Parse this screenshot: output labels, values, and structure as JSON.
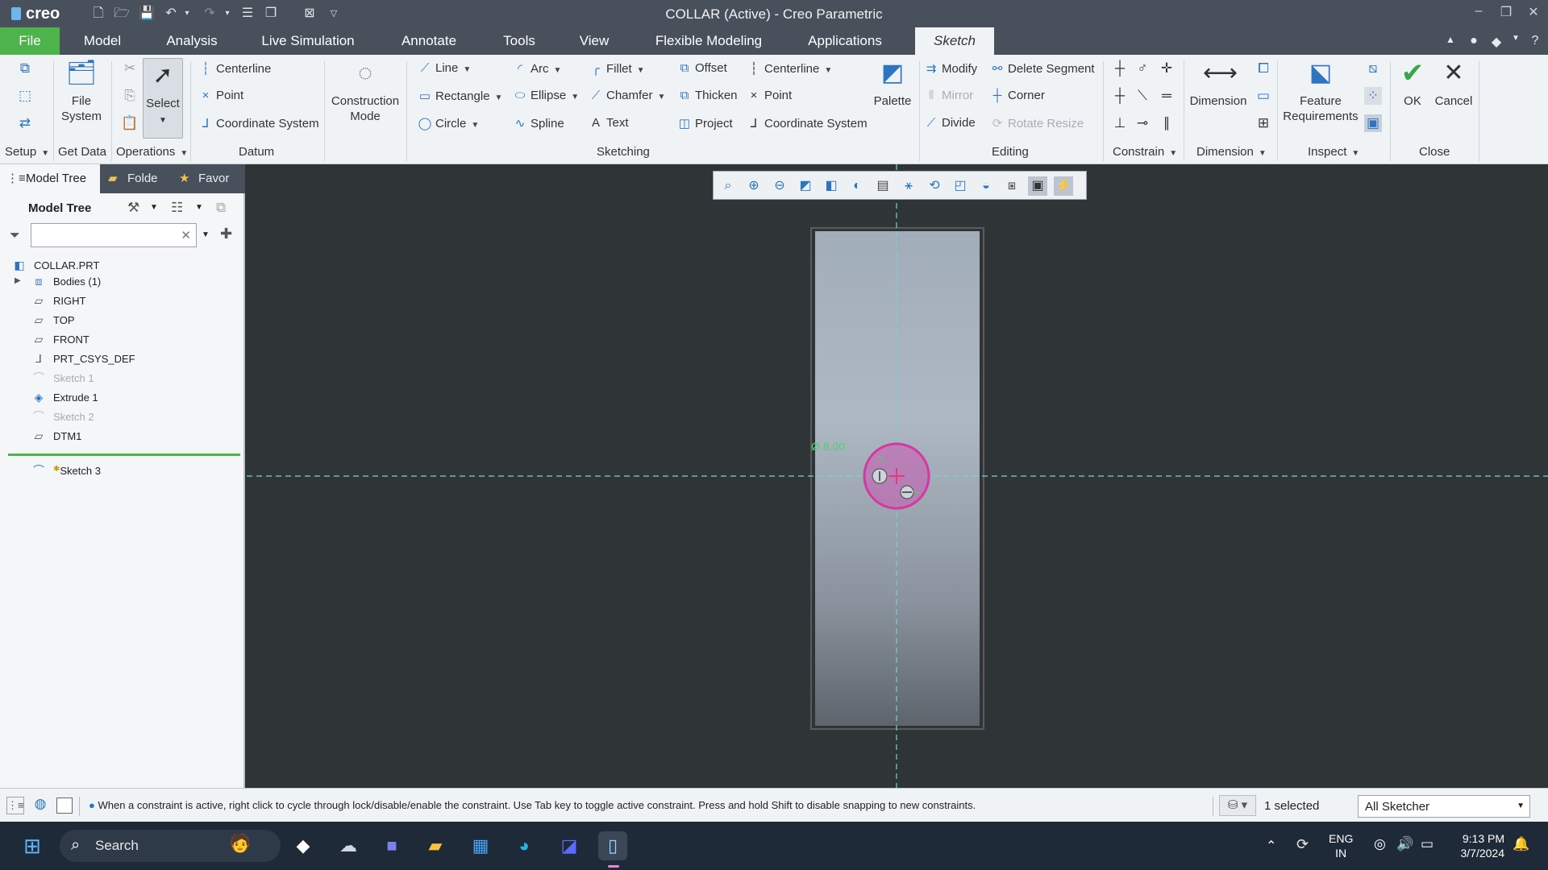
{
  "app": {
    "logo": "creo",
    "window_title": "COLLAR (Active) - Creo Parametric"
  },
  "menu_tabs": {
    "file": "File",
    "model": "Model",
    "analysis": "Analysis",
    "live_simulation": "Live Simulation",
    "annotate": "Annotate",
    "tools": "Tools",
    "view": "View",
    "flexible_modeling": "Flexible Modeling",
    "applications": "Applications",
    "sketch": "Sketch"
  },
  "ribbon": {
    "groups": {
      "setup": "Setup",
      "get_data": "Get Data",
      "operations": "Operations",
      "datum": "Datum",
      "sketching": "Sketching",
      "editing": "Editing",
      "constrain": "Constrain",
      "dimension": "Dimension",
      "inspect": "Inspect",
      "close": "Close"
    },
    "file_system": [
      "File",
      "System"
    ],
    "select": "Select",
    "datum": {
      "centerline": "Centerline",
      "point": "Point",
      "coordinate_system": "Coordinate System"
    },
    "construction_mode": [
      "Construction",
      "Mode"
    ],
    "sketching": {
      "line": "Line",
      "rectangle": "Rectangle",
      "circle": "Circle",
      "arc": "Arc",
      "ellipse": "Ellipse",
      "spline": "Spline",
      "fillet": "Fillet",
      "chamfer": "Chamfer",
      "text": "Text",
      "offset": "Offset",
      "thicken": "Thicken",
      "project": "Project",
      "centerline": "Centerline",
      "point": "Point",
      "coordinate_system": "Coordinate System",
      "palette": "Palette"
    },
    "editing": {
      "modify": "Modify",
      "mirror": "Mirror",
      "divide": "Divide",
      "delete_segment": "Delete Segment",
      "corner": "Corner",
      "rotate_resize": "Rotate Resize"
    },
    "dimension": "Dimension",
    "feature_requirements": [
      "Feature",
      "Requirements"
    ],
    "ok": "OK",
    "cancel": "Cancel"
  },
  "left_panel": {
    "tabs": {
      "model_tree": "Model Tree",
      "folder": "Folde",
      "favorites": "Favor"
    },
    "header": "Model Tree",
    "search_placeholder": "",
    "items": [
      {
        "label": "COLLAR.PRT",
        "icon": "part-icon"
      },
      {
        "label": "Bodies (1)",
        "icon": "bodies-icon"
      },
      {
        "label": "RIGHT",
        "icon": "datum-plane-icon"
      },
      {
        "label": "TOP",
        "icon": "datum-plane-icon"
      },
      {
        "label": "FRONT",
        "icon": "datum-plane-icon"
      },
      {
        "label": "PRT_CSYS_DEF",
        "icon": "csys-icon"
      },
      {
        "label": "Sketch 1",
        "icon": "sketch-icon"
      },
      {
        "label": "Extrude 1",
        "icon": "extrude-icon"
      },
      {
        "label": "Sketch 2",
        "icon": "sketch-icon"
      },
      {
        "label": "DTM1",
        "icon": "datum-plane-icon"
      },
      {
        "label": "Sketch 3",
        "icon": "sketch-icon"
      }
    ]
  },
  "canvas": {
    "dimension_text": "Ø 8.00"
  },
  "status": {
    "message": "When a constraint is active, right click to cycle through lock/disable/enable the constraint. Use Tab key to toggle active constraint. Press and hold Shift to disable snapping to new constraints.",
    "selection": "1 selected",
    "filter": "All Sketcher"
  },
  "taskbar": {
    "search": "Search",
    "lang_top": "ENG",
    "lang_bottom": "IN",
    "time": "9:13 PM",
    "date": "3/7/2024"
  },
  "colors": {
    "file_tab": "#4fb34b",
    "accent_blue": "#2e74c0",
    "sketch_circle": "#d23aa0",
    "centerline": "#6fd6d0",
    "ok_green": "#3aa64b"
  }
}
